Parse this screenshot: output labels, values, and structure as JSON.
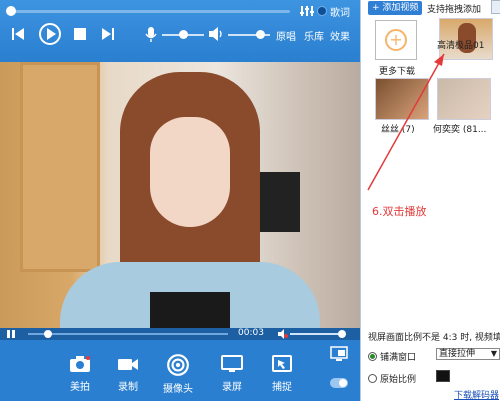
{
  "player": {
    "lyrics_label": "歌词",
    "original_label": "原唱",
    "library_label": "乐库",
    "effects_label": "效果",
    "time": "00:03",
    "seek_progress": 0.02,
    "mic_level": 0.5,
    "volume_level": 0.75
  },
  "toolbar": {
    "items": [
      {
        "label": "美拍",
        "icon": "camera-icon"
      },
      {
        "label": "录制",
        "icon": "video-camera-icon"
      },
      {
        "label": "摄像头",
        "icon": "webcam-icon"
      },
      {
        "label": "录屏",
        "icon": "monitor-icon"
      },
      {
        "label": "捕捉",
        "icon": "capture-icon"
      }
    ]
  },
  "sidebar": {
    "add_video_label": "+ 添加视频",
    "drag_hint": "支持拖拽添加",
    "tiles": [
      {
        "label": "更多下载"
      },
      {
        "label": "高清极品01"
      },
      {
        "label": "丝丝 (7)"
      },
      {
        "label": "何奕奕 (81..."
      }
    ],
    "annotation": "6.双击播放",
    "ratio_text": "视屏画面比例不是 4:3 时, 视频填",
    "option_fill": "铺满窗口",
    "option_original": "原始比例",
    "stretch_select": "直接拉伸",
    "download_link": "下载解码器"
  },
  "colors": {
    "accent": "#2a7fd0",
    "annotation": "#e43939"
  }
}
